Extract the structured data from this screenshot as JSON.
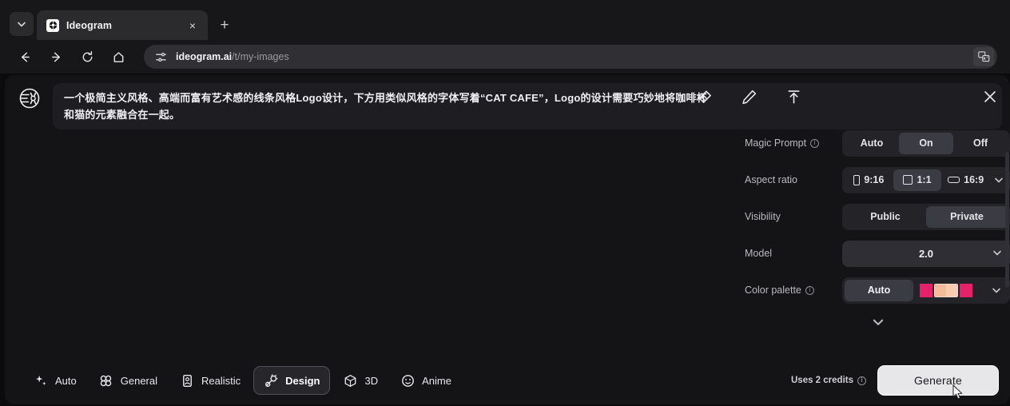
{
  "browser": {
    "tab": {
      "title": "Ideogram",
      "favicon": "ideogram-favicon",
      "close_label": "×"
    },
    "tab_list_label": "⌄",
    "new_tab_label": "+",
    "nav": {
      "back": "←",
      "forward": "→",
      "reload": "⟳",
      "home": "⌂"
    },
    "address": {
      "domain": "ideogram.ai",
      "path": "/t/my-images",
      "site_icon": "tune-icon",
      "translate_icon": "translate-icon"
    }
  },
  "composer": {
    "brand_logo": "ideogram-logo",
    "prompt": "一个极简主义风格、高端而富有艺术感的线条风格Logo设计，下方用类似风格的字体写着“CAT CAFE”，Logo的设计需要巧妙地将咖啡杯和猫的元素融合在一起。",
    "tools": {
      "erase": "eraser-icon",
      "edit": "pencil-icon",
      "upload": "upload-icon",
      "close": "✕"
    }
  },
  "settings": {
    "magic_prompt": {
      "label": "Magic Prompt",
      "has_info": true,
      "options": [
        "Auto",
        "On",
        "Off"
      ],
      "selected": "On"
    },
    "aspect_ratio": {
      "label": "Aspect ratio",
      "options": [
        "9:16",
        "1:1",
        "16:9"
      ],
      "selected": "1:1",
      "chevron": "chevron-down-icon"
    },
    "visibility": {
      "label": "Visibility",
      "options": [
        "Public",
        "Private"
      ],
      "selected": "Private"
    },
    "model": {
      "label": "Model",
      "value": "2.0",
      "chevron": "chevron-down-icon"
    },
    "color_palette": {
      "label": "Color palette",
      "has_info": true,
      "auto_label": "Auto",
      "selected": "Auto",
      "swatches": [
        "#e8206a",
        "#f3bb98",
        "#f6cdb2",
        "#e8206a"
      ],
      "chevron": "chevron-down-icon"
    },
    "expand_more": "chevron-down-icon"
  },
  "bottom": {
    "styles": [
      {
        "label": "Auto",
        "icon": "sparkle-icon",
        "selected": false
      },
      {
        "label": "General",
        "icon": "four-circles-icon",
        "selected": false
      },
      {
        "label": "Realistic",
        "icon": "photo-card-icon",
        "selected": false
      },
      {
        "label": "Design",
        "icon": "design-icon",
        "selected": true
      },
      {
        "label": "3D",
        "icon": "cube-icon",
        "selected": false
      },
      {
        "label": "Anime",
        "icon": "anime-face-icon",
        "selected": false
      }
    ],
    "credits_text": "Uses 2 credits",
    "credits_info": true,
    "generate_label": "Generate"
  },
  "colors": {
    "page_bg": "#0b0b0d",
    "panel_bg": "#141417",
    "prompt_bg": "#1e1e22",
    "segment_track": "#242428",
    "segment_selected": "#3b3b44",
    "generate_bg": "#e7e7e9",
    "accent_pink": "#e8206a"
  }
}
